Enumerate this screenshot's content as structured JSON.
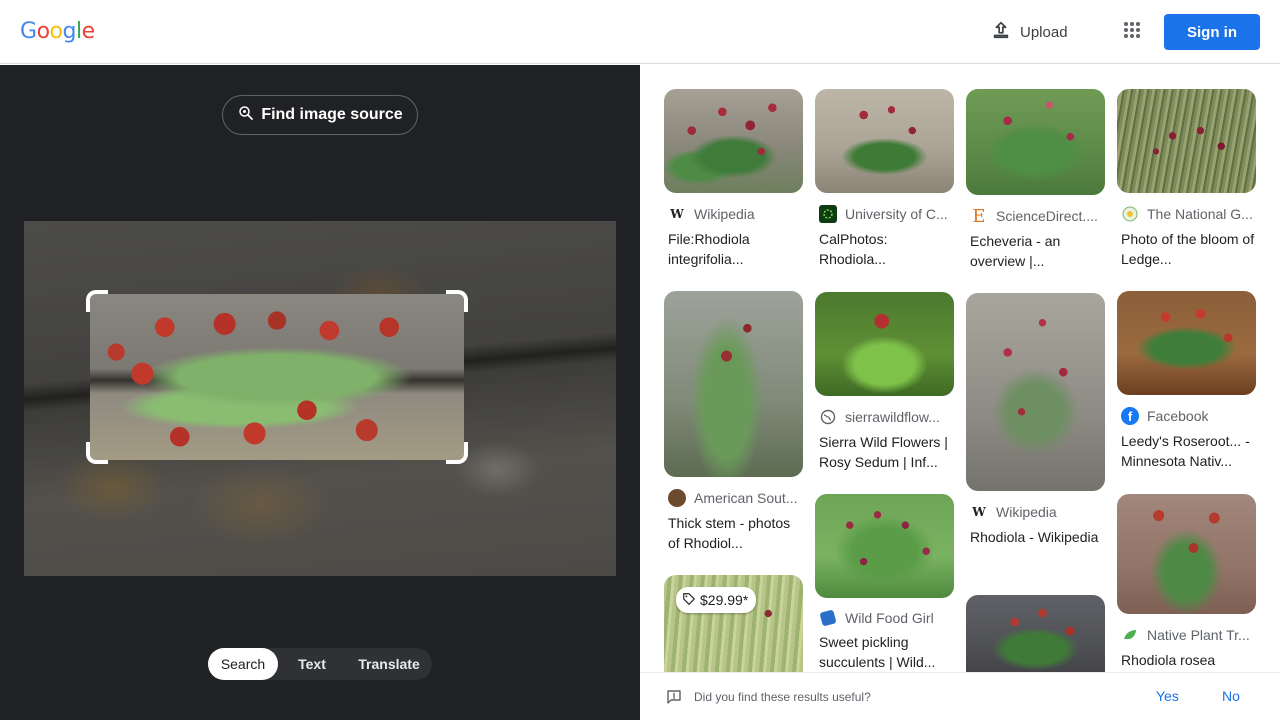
{
  "header": {
    "logo_letters": [
      {
        "ch": "G",
        "color": "#4285F4"
      },
      {
        "ch": "o",
        "color": "#EA4335"
      },
      {
        "ch": "o",
        "color": "#FBBC05"
      },
      {
        "ch": "g",
        "color": "#4285F4"
      },
      {
        "ch": "l",
        "color": "#34A853"
      },
      {
        "ch": "e",
        "color": "#EA4335"
      }
    ],
    "upload_label": "Upload",
    "sign_in_label": "Sign in"
  },
  "lens": {
    "find_source_label": "Find image source",
    "modes": [
      "Search",
      "Text",
      "Translate"
    ],
    "active_mode": "Search"
  },
  "results": [
    {
      "source": "Wikipedia",
      "icon": "W",
      "title": "File:Rhodiola integrifolia..."
    },
    {
      "source": "University of C...",
      "icon": "calphotos",
      "title": "CalPhotos: Rhodiola..."
    },
    {
      "source": "ScienceDirect....",
      "icon": "E",
      "title": "Echeveria - an overview |..."
    },
    {
      "source": "The National G...",
      "icon": "national-garden",
      "title": "Photo of the bloom of Ledge..."
    },
    {
      "source": "American Sout...",
      "icon": "american-southwest",
      "title": "Thick stem - photos of Rhodiol..."
    },
    {
      "source": "sierrawildflow...",
      "icon": "globe",
      "title": "Sierra Wild Flowers | Rosy Sedum | Inf..."
    },
    {
      "source": "Wikipedia",
      "icon": "W",
      "title": "Rhodiola - Wikipedia"
    },
    {
      "source": "Facebook",
      "icon": "f",
      "title": "Leedy's Roseroot... - Minnesota Nativ..."
    },
    {
      "source": "Wild Food Girl",
      "icon": "wild-food",
      "title": "Sweet pickling succulents | Wild..."
    },
    {
      "source": "Native Plant Tr...",
      "icon": "leaf",
      "title": "Rhodiola rosea"
    },
    {
      "price": "$29.99*"
    }
  ],
  "feedback": {
    "question": "Did you find these results useful?",
    "yes": "Yes",
    "no": "No"
  }
}
